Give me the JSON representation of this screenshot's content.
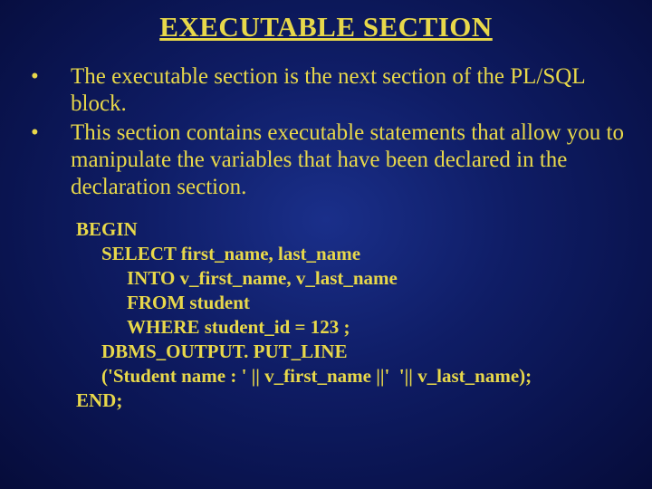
{
  "title": "EXECUTABLE SECTION",
  "bullets": [
    "The executable section is the next section of the PL/SQL block.",
    "This section contains executable statements that allow you to manipulate the variables that have been declared in the declaration section."
  ],
  "code": {
    "l0": "BEGIN",
    "l1": "SELECT first_name, last_name",
    "l2": "INTO v_first_name, v_last_name",
    "l3": "FROM student",
    "l4": "WHERE student_id = 123 ;",
    "l5": "DBMS_OUTPUT. PUT_LINE",
    "l6": "('Student name : ' || v_first_name ||'  '|| v_last_name);",
    "l7": "END;"
  }
}
